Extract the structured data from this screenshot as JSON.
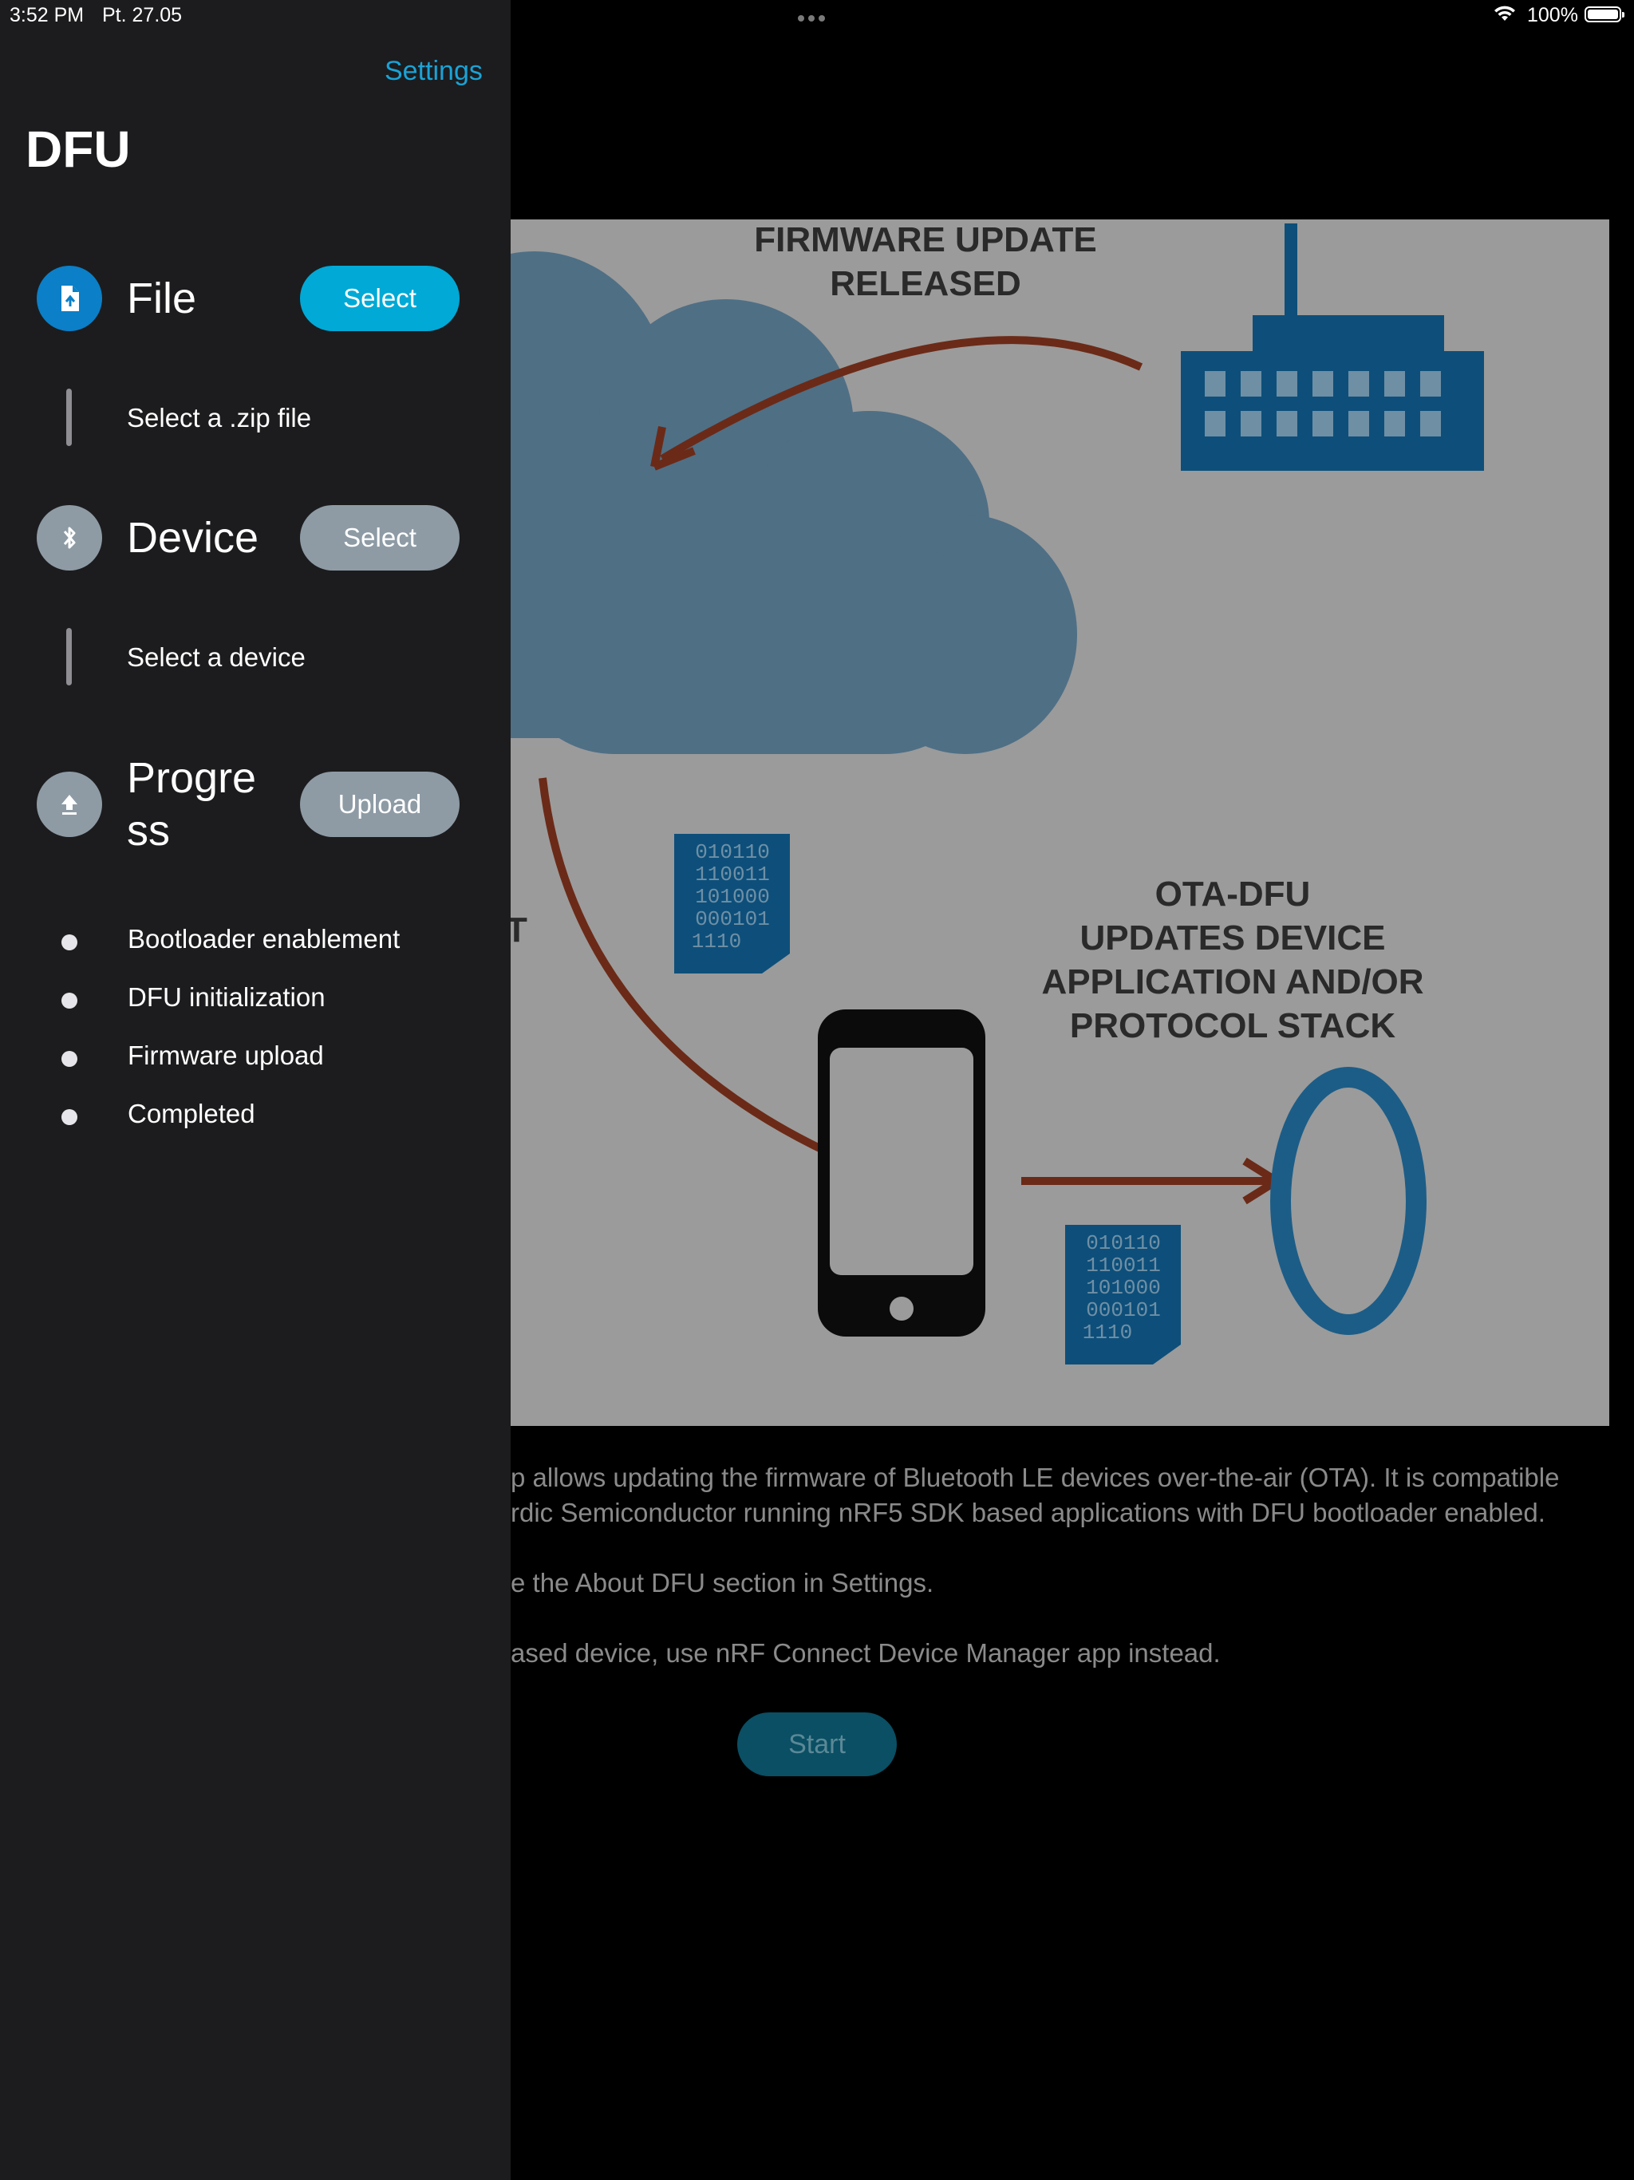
{
  "status_bar": {
    "time": "3:52 PM",
    "date": "Pt. 27.05",
    "battery": "100%"
  },
  "panel": {
    "settings_label": "Settings",
    "title": "DFU",
    "file": {
      "label": "File",
      "button": "Select",
      "hint": "Select a .zip file"
    },
    "device": {
      "label": "Device",
      "button": "Select",
      "hint": "Select a device"
    },
    "progress": {
      "label_line1": "Progre",
      "label_line2": "ss",
      "button": "Upload",
      "steps": [
        "Bootloader enablement",
        "DFU initialization",
        "Firmware upload",
        "Completed"
      ]
    }
  },
  "illustration": {
    "heading1_line1": "FIRMWARE UPDATE",
    "heading1_line2": "RELEASED",
    "heading2_line1": "OTA-DFU",
    "heading2_line2": "UPDATES DEVICE",
    "heading2_line3": "APPLICATION AND/OR",
    "heading2_line4": "PROTOCOL STACK",
    "partial_char": "T",
    "binary_lines": [
      "010110",
      "110011",
      "101000",
      "000101",
      "1110"
    ]
  },
  "main": {
    "desc_line1": "p allows updating the firmware of Bluetooth LE devices over-the-air (OTA). It is compatible",
    "desc_line2": "rdic Semiconductor running nRF5 SDK based applications with DFU bootloader enabled.",
    "desc_line3": "e the About DFU section in Settings.",
    "desc_line4": "ased device, use nRF Connect Device Manager app instead.",
    "start_button": "Start"
  },
  "colors": {
    "accent": "#1aa3d6",
    "button_blue": "#00a9d6",
    "button_gray": "#8e9ba5",
    "panel_bg": "#1c1c1e"
  }
}
